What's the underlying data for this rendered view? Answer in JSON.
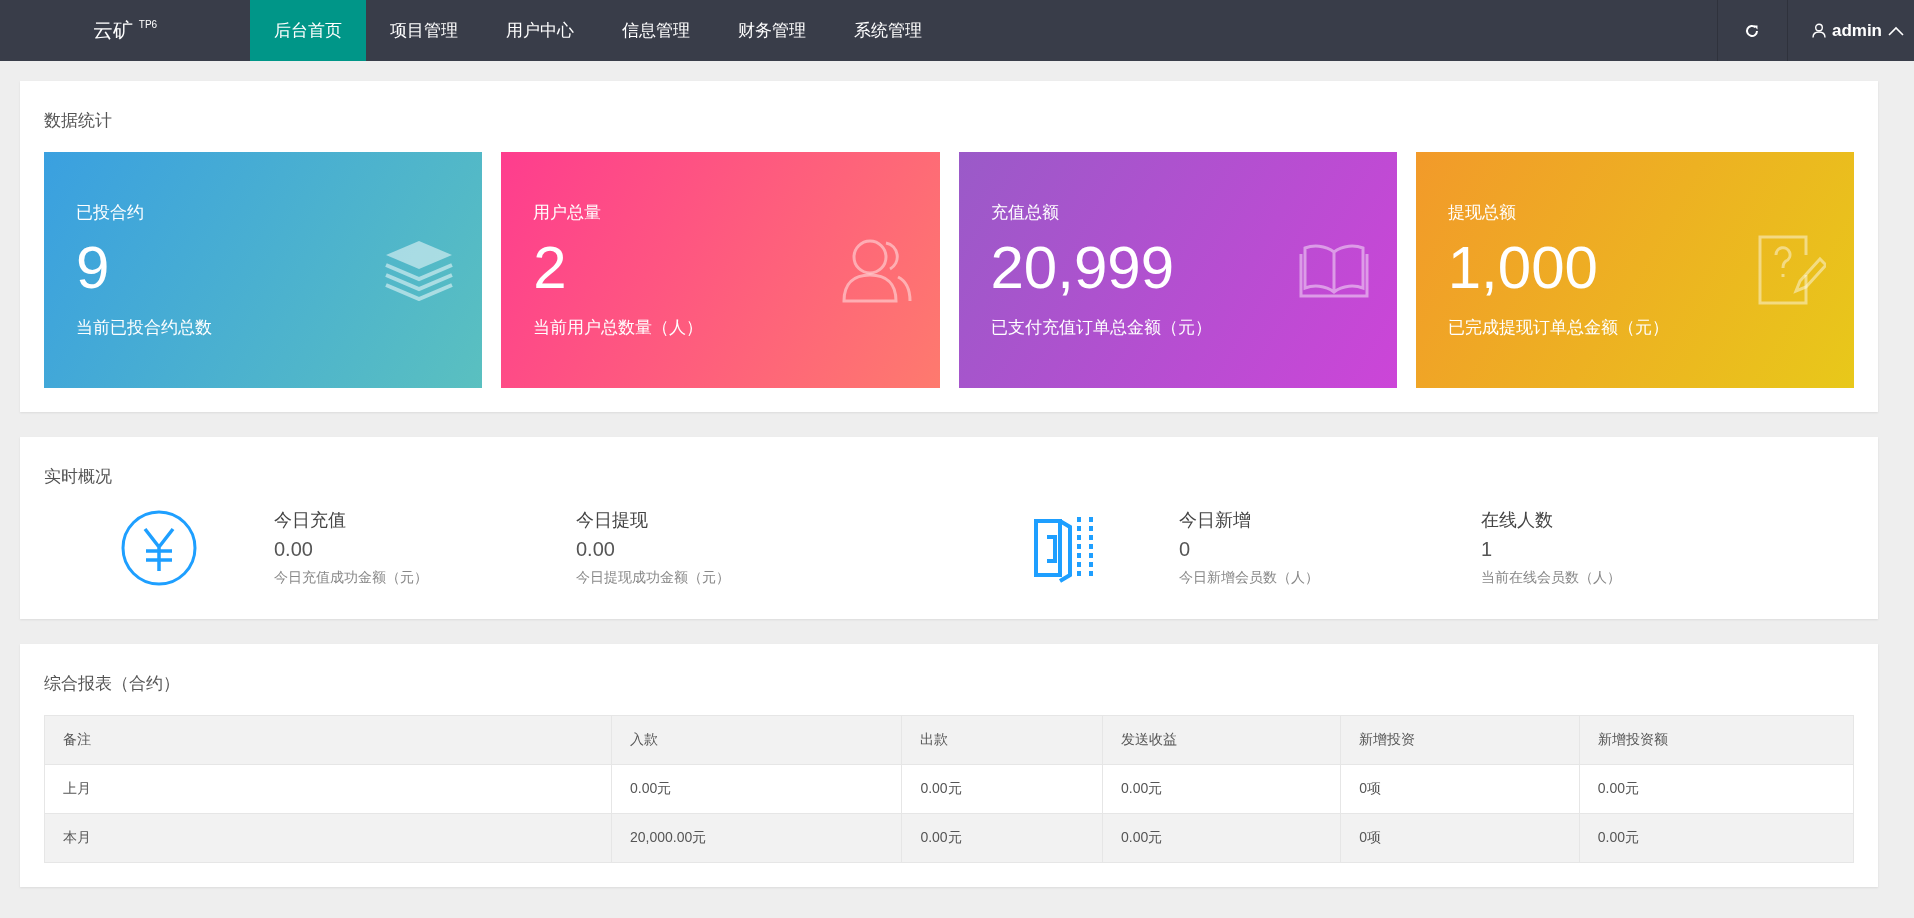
{
  "header": {
    "logo": "云矿",
    "logo_badge": "TP6",
    "nav": [
      {
        "label": "后台首页",
        "selected": true
      },
      {
        "label": "项目管理",
        "selected": false
      },
      {
        "label": "用户中心",
        "selected": false
      },
      {
        "label": "信息管理",
        "selected": false
      },
      {
        "label": "财务管理",
        "selected": false
      },
      {
        "label": "系统管理",
        "selected": false
      }
    ],
    "user": "admin"
  },
  "stats": {
    "title": "数据统计",
    "cards": [
      {
        "kind": "layers",
        "label": "已投合约",
        "value": "9",
        "note": "当前已投合约总数"
      },
      {
        "kind": "users",
        "label": "用户总量",
        "value": "2",
        "note": "当前用户总数量（人）"
      },
      {
        "kind": "book",
        "label": "充值总额",
        "value": "20,999",
        "note": "已支付充值订单总金额（元）"
      },
      {
        "kind": "question",
        "label": "提现总额",
        "value": "1,000",
        "note": "已完成提现订单总金额（元）"
      }
    ]
  },
  "realtime": {
    "title": "实时概况",
    "groups": [
      {
        "kind": "yen",
        "items": [
          {
            "label": "今日充值",
            "value": "0.00",
            "note": "今日充值成功金额（元）"
          },
          {
            "label": "今日提现",
            "value": "0.00",
            "note": "今日提现成功金额（元）"
          }
        ]
      },
      {
        "kind": "door",
        "items": [
          {
            "label": "今日新增",
            "value": "0",
            "note": "今日新增会员数（人）"
          },
          {
            "label": "在线人数",
            "value": "1",
            "note": "当前在线会员数（人）"
          }
        ]
      }
    ]
  },
  "report": {
    "title": "综合报表（合约）",
    "columns": [
      "备注",
      "入款",
      "出款",
      "发送收益",
      "新增投资",
      "新增投资额"
    ],
    "rows": [
      [
        "上月",
        "0.00元",
        "0.00元",
        "0.00元",
        "0项",
        "0.00元"
      ],
      [
        "本月",
        "20,000.00元",
        "0.00元",
        "0.00元",
        "0项",
        "0.00元"
      ]
    ]
  }
}
